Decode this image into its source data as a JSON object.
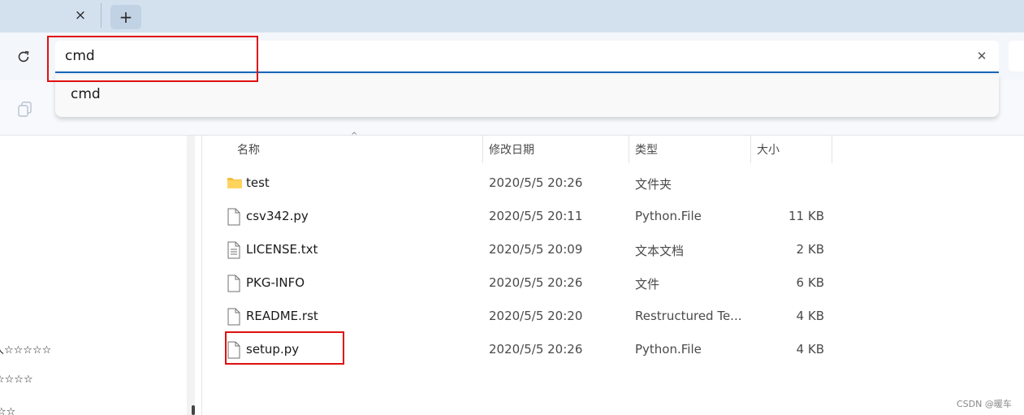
{
  "tabstrip": {
    "close_icon": "×",
    "new_tab_icon": "+"
  },
  "toolbar": {
    "address_value": "cmd",
    "clear_icon": "✕"
  },
  "suggestions": [
    "cmd"
  ],
  "navpane": {
    "partial_rows": [
      "人☆☆☆☆☆",
      "☆☆☆☆",
      "☆☆"
    ]
  },
  "columns": {
    "name": "名称",
    "modified": "修改日期",
    "type": "类型",
    "size": "大小"
  },
  "files": [
    {
      "name": "test",
      "date": "2020/5/5 20:26",
      "type": "文件夹",
      "size": "",
      "icon": "folder-icon"
    },
    {
      "name": "csv342.py",
      "date": "2020/5/5 20:11",
      "type": "Python.File",
      "size": "11 KB",
      "icon": "file-icon"
    },
    {
      "name": "LICENSE.txt",
      "date": "2020/5/5 20:09",
      "type": "文本文档",
      "size": "2 KB",
      "icon": "text-file-icon"
    },
    {
      "name": "PKG-INFO",
      "date": "2020/5/5 20:26",
      "type": "文件",
      "size": "6 KB",
      "icon": "file-icon"
    },
    {
      "name": "README.rst",
      "date": "2020/5/5 20:20",
      "type": "Restructured Te...",
      "size": "4 KB",
      "icon": "file-icon"
    },
    {
      "name": "setup.py",
      "date": "2020/5/5 20:26",
      "type": "Python.File",
      "size": "4 KB",
      "icon": "file-icon"
    }
  ],
  "watermark": "CSDN @暖车",
  "colors": {
    "accent": "#1864b8",
    "highlight": "#e01010",
    "folder": "#f4c042"
  }
}
